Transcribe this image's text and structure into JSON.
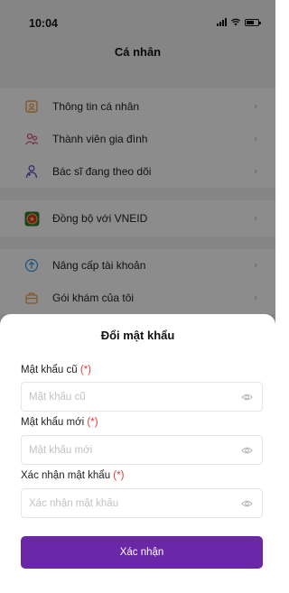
{
  "status_bar": {
    "time": "10:04"
  },
  "header": {
    "title": "Cá nhân"
  },
  "menu": {
    "items": [
      {
        "label": "Thông tin cá nhân",
        "icon": "profile-card-icon",
        "color": "#f0a24b"
      },
      {
        "label": "Thành viên gia đình",
        "icon": "family-icon",
        "color": "#e0567a"
      },
      {
        "label": "Bác sĩ đang theo dõi",
        "icon": "doctor-icon",
        "color": "#6b4fc4"
      },
      {
        "label": "Đồng bộ với VNEID",
        "icon": "vneid-emblem-icon",
        "color": "#2e7d32"
      },
      {
        "label": "Nâng cấp tài khoản",
        "icon": "upgrade-icon",
        "color": "#3fa0e0"
      },
      {
        "label": "Gói khám của tôi",
        "icon": "package-icon",
        "color": "#f0a24b"
      }
    ]
  },
  "dialog": {
    "title": "Đổi mật khẩu",
    "required_mark": "(*)",
    "fields": [
      {
        "label": "Mật khẩu cũ",
        "placeholder": "Mật khẩu cũ",
        "value": ""
      },
      {
        "label": "Mật khẩu mới",
        "placeholder": "Mật khẩu mới",
        "value": ""
      },
      {
        "label": "Xác nhận mật khẩu",
        "placeholder": "Xác nhận mật khẩu",
        "value": ""
      }
    ],
    "submit_label": "Xác nhận"
  },
  "colors": {
    "accent": "#6a27a8",
    "required": "#e53935"
  }
}
